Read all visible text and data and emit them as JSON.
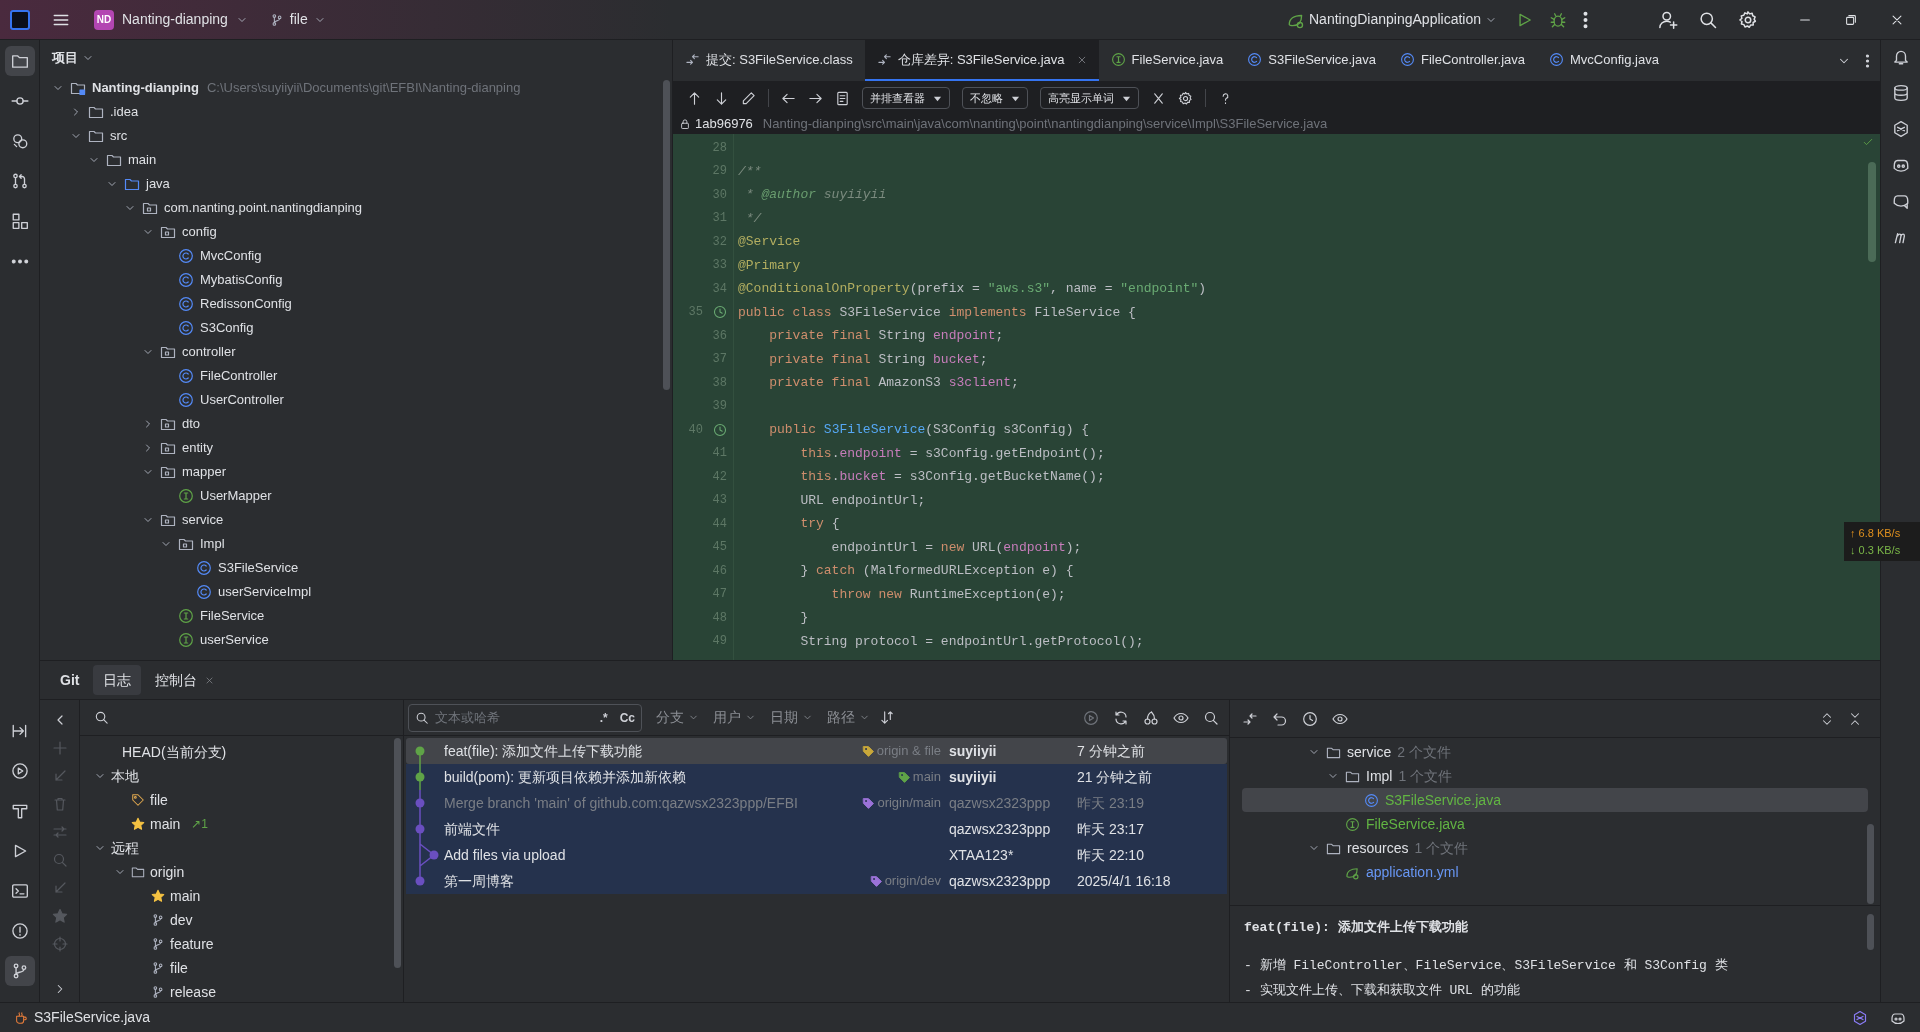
{
  "title_bar": {
    "project_badge": "ND",
    "project": "Nanting-dianping",
    "branch": "file",
    "run_config": "NantingDianpingApplication"
  },
  "left_toolbar": [
    {
      "kind": "folder",
      "selected": true
    },
    {
      "kind": "commit",
      "selected": false
    },
    {
      "kind": "plugin",
      "selected": false
    },
    {
      "kind": "pull",
      "selected": false
    },
    {
      "kind": "structure",
      "selected": false
    },
    {
      "kind": "more",
      "selected": false
    }
  ],
  "left_toolbar_bottom": [
    {
      "kind": "deploy",
      "selected": false
    },
    {
      "kind": "services",
      "selected": false
    },
    {
      "kind": "build",
      "selected": false
    },
    {
      "kind": "run",
      "selected": false
    },
    {
      "kind": "terminal",
      "selected": false
    },
    {
      "kind": "problems",
      "selected": false
    },
    {
      "kind": "git",
      "selected": true
    }
  ],
  "project_panel": {
    "title": "项目",
    "tree": [
      {
        "label": "Nanting-dianping",
        "kind": "module",
        "path": "C:\\Users\\suyiiyii\\Documents\\git\\EFBI\\Nanting-dianping",
        "expanded": true,
        "children": [
          {
            "label": ".idea",
            "kind": "folder",
            "expanded": false
          },
          {
            "label": "src",
            "kind": "folder",
            "expanded": true,
            "children": [
              {
                "label": "main",
                "kind": "folder",
                "expanded": true,
                "children": [
                  {
                    "label": "java",
                    "kind": "source",
                    "expanded": true,
                    "children": [
                      {
                        "label": "com.nanting.point.nantingdianping",
                        "kind": "package",
                        "expanded": true,
                        "children": [
                          {
                            "label": "config",
                            "kind": "package",
                            "expanded": true,
                            "children": [
                              {
                                "label": "MvcConfig",
                                "kind": "class"
                              },
                              {
                                "label": "MybatisConfig",
                                "kind": "class"
                              },
                              {
                                "label": "RedissonConfig",
                                "kind": "class"
                              },
                              {
                                "label": "S3Config",
                                "kind": "class"
                              }
                            ]
                          },
                          {
                            "label": "controller",
                            "kind": "package",
                            "expanded": true,
                            "children": [
                              {
                                "label": "FileController",
                                "kind": "class"
                              },
                              {
                                "label": "UserController",
                                "kind": "class"
                              }
                            ]
                          },
                          {
                            "label": "dto",
                            "kind": "package",
                            "expanded": false
                          },
                          {
                            "label": "entity",
                            "kind": "package",
                            "expanded": false
                          },
                          {
                            "label": "mapper",
                            "kind": "package",
                            "expanded": true,
                            "children": [
                              {
                                "label": "UserMapper",
                                "kind": "interface"
                              }
                            ]
                          },
                          {
                            "label": "service",
                            "kind": "package",
                            "expanded": true,
                            "children": [
                              {
                                "label": "Impl",
                                "kind": "package",
                                "expanded": true,
                                "children": [
                                  {
                                    "label": "S3FileService",
                                    "kind": "class"
                                  },
                                  {
                                    "label": "userServiceImpl",
                                    "kind": "class"
                                  }
                                ]
                              },
                              {
                                "label": "FileService",
                                "kind": "interface"
                              },
                              {
                                "label": "userService",
                                "kind": "interface"
                              }
                            ]
                          }
                        ]
                      }
                    ]
                  }
                ]
              }
            ]
          }
        ]
      }
    ]
  },
  "editor_tabs": [
    {
      "label": "提交: S3FileService.class",
      "kind": "diff",
      "selected": false,
      "closable": false
    },
    {
      "label": "仓库差异: S3FileService.java",
      "kind": "diff",
      "selected": true,
      "closable": true
    },
    {
      "label": "FileService.java",
      "kind": "interface",
      "selected": false,
      "closable": false
    },
    {
      "label": "S3FileService.java",
      "kind": "class",
      "selected": false,
      "closable": false
    },
    {
      "label": "FileController.java",
      "kind": "class",
      "selected": false,
      "closable": false
    },
    {
      "label": "MvcConfig.java",
      "kind": "class",
      "selected": false,
      "closable": false
    }
  ],
  "diff_toolbar": {
    "viewer": "并排查看器",
    "whitespace": "不忽略",
    "highlight": "高亮显示单词"
  },
  "diff_header": {
    "revision": "1ab96976",
    "path": "Nanting-dianping\\src\\main\\java\\com\\nanting\\point\\nantingdianping\\service\\Impl\\S3FileService.java"
  },
  "code_lines": [
    {
      "number": "28",
      "gutter_icon": false
    },
    {
      "number": "29",
      "gutter_icon": false,
      "tokens": [
        {
          "kind": "comment",
          "text": "/**"
        }
      ]
    },
    {
      "number": "30",
      "gutter_icon": false,
      "tokens": [
        {
          "kind": "comment",
          "text": " * "
        },
        {
          "kind": "doctag",
          "text": "@author"
        },
        {
          "kind": "comment",
          "text": " suyiiyii"
        }
      ]
    },
    {
      "number": "31",
      "gutter_icon": false,
      "tokens": [
        {
          "kind": "comment",
          "text": " */"
        }
      ]
    },
    {
      "number": "32",
      "gutter_icon": false,
      "tokens": [
        {
          "kind": "annotation",
          "text": "@Service"
        }
      ]
    },
    {
      "number": "33",
      "gutter_icon": false,
      "tokens": [
        {
          "kind": "annotation",
          "text": "@Primary"
        }
      ]
    },
    {
      "number": "34",
      "gutter_icon": false,
      "tokens": [
        {
          "kind": "annotation",
          "text": "@ConditionalOnProperty"
        },
        {
          "kind": "plain",
          "text": "(prefix = "
        },
        {
          "kind": "string",
          "text": "\"aws.s3\""
        },
        {
          "kind": "plain",
          "text": ", name = "
        },
        {
          "kind": "string",
          "text": "\"endpoint\""
        },
        {
          "kind": "plain",
          "text": ")"
        }
      ]
    },
    {
      "number": "35",
      "gutter_icon": true,
      "tokens": [
        {
          "kind": "keyword",
          "text": "public class "
        },
        {
          "kind": "plain",
          "text": "S3FileService "
        },
        {
          "kind": "keyword",
          "text": "implements "
        },
        {
          "kind": "plain",
          "text": "FileService {"
        }
      ]
    },
    {
      "number": "36",
      "gutter_icon": false,
      "tokens": [
        {
          "kind": "keyword",
          "text": "    private final "
        },
        {
          "kind": "plain",
          "text": "String "
        },
        {
          "kind": "field",
          "text": "endpoint"
        },
        {
          "kind": "plain",
          "text": ";"
        }
      ]
    },
    {
      "number": "37",
      "gutter_icon": false,
      "tokens": [
        {
          "kind": "keyword",
          "text": "    private final "
        },
        {
          "kind": "plain",
          "text": "String "
        },
        {
          "kind": "field",
          "text": "bucket"
        },
        {
          "kind": "plain",
          "text": ";"
        }
      ]
    },
    {
      "number": "38",
      "gutter_icon": false,
      "tokens": [
        {
          "kind": "keyword",
          "text": "    private final "
        },
        {
          "kind": "plain",
          "text": "AmazonS3 "
        },
        {
          "kind": "field",
          "text": "s3client"
        },
        {
          "kind": "plain",
          "text": ";"
        }
      ]
    },
    {
      "number": "39",
      "gutter_icon": false
    },
    {
      "number": "40",
      "gutter_icon": true,
      "tokens": [
        {
          "kind": "keyword",
          "text": "    public "
        },
        {
          "kind": "method",
          "text": "S3FileService"
        },
        {
          "kind": "plain",
          "text": "(S3Config s3Config) {"
        }
      ]
    },
    {
      "number": "41",
      "gutter_icon": false,
      "tokens": [
        {
          "kind": "keyword",
          "text": "        this"
        },
        {
          "kind": "plain",
          "text": "."
        },
        {
          "kind": "field",
          "text": "endpoint"
        },
        {
          "kind": "plain",
          "text": " = s3Config.getEndpoint();"
        }
      ]
    },
    {
      "number": "42",
      "gutter_icon": false,
      "tokens": [
        {
          "kind": "keyword",
          "text": "        this"
        },
        {
          "kind": "plain",
          "text": "."
        },
        {
          "kind": "field",
          "text": "bucket"
        },
        {
          "kind": "plain",
          "text": " = s3Config.getBucketName();"
        }
      ]
    },
    {
      "number": "43",
      "gutter_icon": false,
      "tokens": [
        {
          "kind": "plain",
          "text": "        URL endpointUrl;"
        }
      ]
    },
    {
      "number": "44",
      "gutter_icon": false,
      "tokens": [
        {
          "kind": "keyword",
          "text": "        try "
        },
        {
          "kind": "plain",
          "text": "{"
        }
      ]
    },
    {
      "number": "45",
      "gutter_icon": false,
      "tokens": [
        {
          "kind": "plain",
          "text": "            endpointUrl = "
        },
        {
          "kind": "keyword",
          "text": "new "
        },
        {
          "kind": "plain",
          "text": "URL("
        },
        {
          "kind": "field",
          "text": "endpoint"
        },
        {
          "kind": "plain",
          "text": ");"
        }
      ]
    },
    {
      "number": "46",
      "gutter_icon": false,
      "tokens": [
        {
          "kind": "plain",
          "text": "        } "
        },
        {
          "kind": "keyword",
          "text": "catch "
        },
        {
          "kind": "plain",
          "text": "(MalformedURLException e) {"
        }
      ]
    },
    {
      "number": "47",
      "gutter_icon": false,
      "tokens": [
        {
          "kind": "keyword",
          "text": "            throw new "
        },
        {
          "kind": "plain",
          "text": "RuntimeException(e);"
        }
      ]
    },
    {
      "number": "48",
      "gutter_icon": false,
      "tokens": [
        {
          "kind": "plain",
          "text": "        }"
        }
      ]
    },
    {
      "number": "49",
      "gutter_icon": false,
      "tokens": [
        {
          "kind": "plain",
          "text": "        String protocol = endpointUrl.getProtocol();"
        }
      ]
    }
  ],
  "net_speed": {
    "upload": "↑ 6.8 KB/s",
    "download": "↓ 0.3 KB/s"
  },
  "right_toolbar": [
    {
      "kind": "bell"
    },
    {
      "kind": "database"
    },
    {
      "kind": "ai"
    },
    {
      "kind": "copilot"
    },
    {
      "kind": "copilot-chat"
    },
    {
      "kind": "m"
    }
  ],
  "bottom_tabs": [
    {
      "label": "Git",
      "selected": false,
      "closable": false
    },
    {
      "label": "日志",
      "selected": true,
      "closable": false
    },
    {
      "label": "控制台",
      "selected": false,
      "closable": true
    }
  ],
  "branches": [
    {
      "label": "HEAD(当前分支)",
      "kind": "head"
    },
    {
      "label": "本地",
      "kind": "group",
      "expanded": true,
      "children": [
        {
          "label": "file",
          "kind": "tag"
        },
        {
          "label": "main",
          "kind": "star",
          "badge": "↗1"
        }
      ]
    },
    {
      "label": "远程",
      "kind": "group",
      "expanded": true,
      "children": [
        {
          "label": "origin",
          "kind": "folder",
          "expanded": true,
          "children": [
            {
              "label": "main",
              "kind": "star"
            },
            {
              "label": "dev",
              "kind": "branch"
            },
            {
              "label": "feature",
              "kind": "branch"
            },
            {
              "label": "file",
              "kind": "branch"
            },
            {
              "label": "release",
              "kind": "branch"
            }
          ]
        }
      ]
    }
  ],
  "log_filters": {
    "placeholder": "文本或哈希",
    "regex": ".*",
    "case": "Cc",
    "filters": [
      "分支",
      "用户",
      "日期",
      "路径"
    ]
  },
  "commits": [
    {
      "message": "feat(file): 添加文件上传下载功能",
      "ref": {
        "label": "origin & file",
        "color": "#c9a83a"
      },
      "author": "suyiiyii",
      "author_bold": true,
      "date": "7 分钟之前",
      "selected": true,
      "dimmed": false,
      "side_lane": false,
      "color": "#5fa347"
    },
    {
      "message": "build(pom): 更新项目依赖并添加新依赖",
      "ref": {
        "label": "main",
        "color": "#5fa347"
      },
      "author": "suyiiyii",
      "author_bold": true,
      "date": "21 分钟之前",
      "selected": false,
      "dimmed": false,
      "side_lane": false,
      "color": "#5fa347"
    },
    {
      "message": "Merge branch 'main' of github.com:qazwsx2323ppp/EFBI",
      "ref": {
        "label": "origin/main",
        "color": "#9b72d8"
      },
      "author": "qazwsx2323ppp",
      "author_bold": false,
      "date": "昨天 23:19",
      "selected": false,
      "dimmed": true,
      "side_lane": false,
      "color": "#6a4fc0"
    },
    {
      "message": "前端文件",
      "author": "qazwsx2323ppp",
      "author_bold": false,
      "date": "昨天 23:17",
      "selected": false,
      "dimmed": false,
      "side_lane": false,
      "color": "#6a4fc0"
    },
    {
      "message": "Add files via upload",
      "author": "XTAA123*",
      "author_bold": false,
      "date": "昨天 22:10",
      "selected": false,
      "dimmed": false,
      "side_lane": true,
      "color": "#6a4fc0"
    },
    {
      "message": "第一周博客",
      "ref": {
        "label": "origin/dev",
        "color": "#9b72d8"
      },
      "author": "qazwsx2323ppp",
      "author_bold": false,
      "date": "2025/4/1 16:18",
      "selected": false,
      "dimmed": false,
      "side_lane": false,
      "color": "#6a4fc0"
    }
  ],
  "changes": [
    {
      "label": "service",
      "kind": "folder",
      "count": "2 个文件",
      "expanded": true,
      "children": [
        {
          "label": "Impl",
          "kind": "folder",
          "count": "1 个文件",
          "expanded": true,
          "children": [
            {
              "label": "S3FileService.java",
              "kind": "class",
              "added": true,
              "selected": true
            }
          ]
        },
        {
          "label": "FileService.java",
          "kind": "interface",
          "added": true,
          "selected": false
        }
      ]
    },
    {
      "label": "resources",
      "kind": "folder",
      "count": "1 个文件",
      "expanded": true,
      "children": [
        {
          "label": "application.yml",
          "kind": "yml",
          "added": false,
          "selected": false
        }
      ]
    }
  ],
  "commit_details": {
    "title": "feat(file): 添加文件上传下载功能",
    "body": [
      "- 新增 FileController、FileService、S3FileService 和 S3Config 类",
      "- 实现文件上传、下载和获取文件 URL 的功能"
    ]
  },
  "status_bar": {
    "file": "S3FileService.java"
  }
}
